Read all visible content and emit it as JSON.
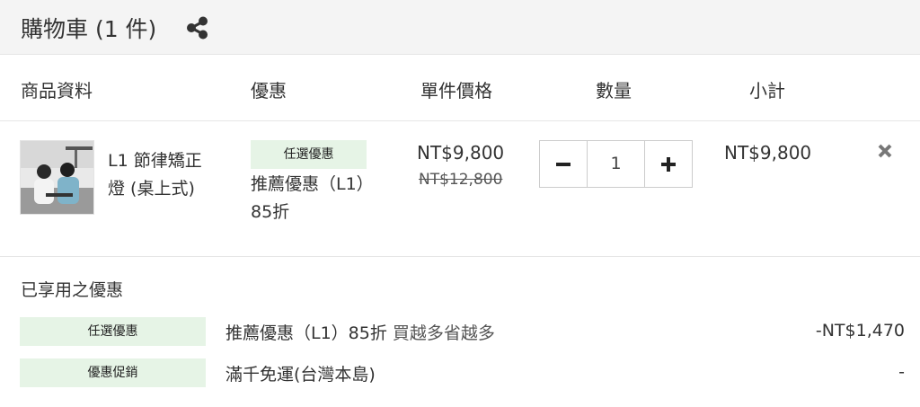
{
  "header": {
    "title": "購物車 (1 件)",
    "share_icon": "share-icon"
  },
  "columns": {
    "product": "商品資料",
    "discount": "優惠",
    "unit_price": "單件價格",
    "quantity": "數量",
    "subtotal": "小計"
  },
  "item": {
    "name": "L1 節律矯正燈 (桌上式)",
    "tag": "任選優惠",
    "promo": "推薦優惠（L1）85折",
    "price": "NT$9,800",
    "original_price": "NT$12,800",
    "quantity": "1",
    "subtotal": "NT$9,800",
    "remove_icon": "close-icon"
  },
  "applied": {
    "title": "已享用之優惠",
    "rows": [
      {
        "tag": "任選優惠",
        "text": "推薦優惠（L1）85折",
        "subtext": "買越多省越多",
        "amount": "-NT$1,470"
      },
      {
        "tag": "優惠促銷",
        "text": "滿千免運(台灣本島)",
        "subtext": "",
        "amount": "-"
      }
    ]
  },
  "colors": {
    "tag_bg": "#e6f4e6",
    "header_bg": "#f4f4f4",
    "border": "#e6e6e6"
  }
}
